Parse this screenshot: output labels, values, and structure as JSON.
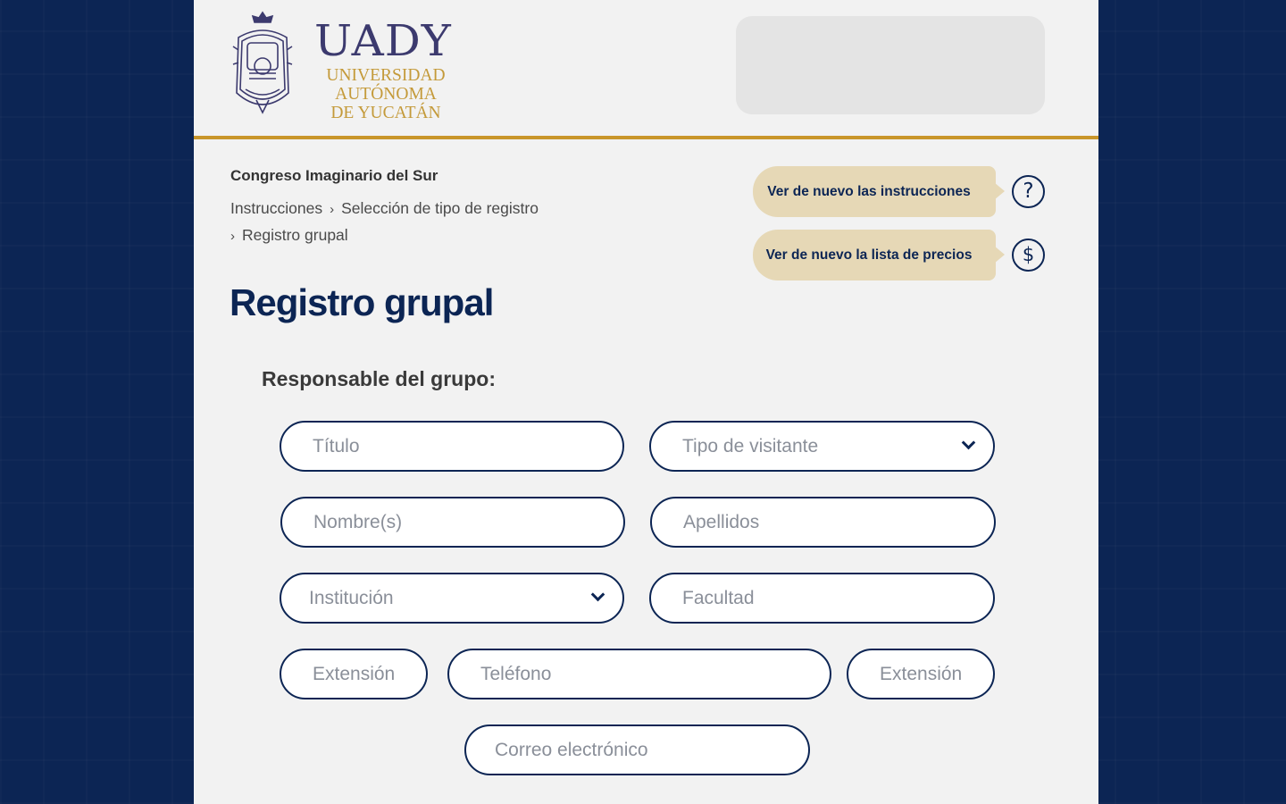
{
  "header": {
    "logo_title": "UADY",
    "logo_lines": [
      "UNIVERSIDAD",
      "AUTÓNOMA",
      "DE YUCATÁN"
    ]
  },
  "breadcrumb": {
    "event": "Congreso Imaginario del Sur",
    "items": [
      "Instrucciones",
      "Selección de tipo de registro",
      "Registro grupal"
    ],
    "separator": "›"
  },
  "help": {
    "instructions_label": "Ver de nuevo las instrucciones",
    "prices_label": "Ver de nuevo la lista de precios",
    "instructions_icon": "question-icon",
    "prices_icon": "dollar-icon"
  },
  "main": {
    "title": "Registro grupal",
    "section_title": "Responsable del grupo:"
  },
  "form": {
    "titulo": "Título",
    "tipo_visitante": "Tipo de visitante",
    "nombre": "Nombre(s)",
    "apellidos": "Apellidos",
    "institucion": "Institución",
    "facultad": "Facultad",
    "extension_1": "Extensión",
    "telefono": "Teléfono",
    "extension_2": "Extensión",
    "correo": "Correo electrónico"
  },
  "colors": {
    "navy": "#0c2554",
    "gold": "#c9962a",
    "help_button": "#e6d8b6"
  }
}
